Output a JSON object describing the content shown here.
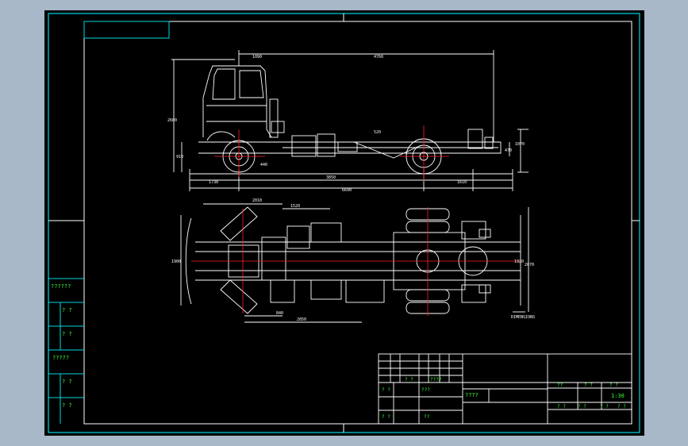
{
  "sidebar": {
    "labels": [
      "??????",
      "? ?",
      "? ?",
      "?????",
      "? ?",
      "? ?"
    ]
  },
  "title_block": {
    "left_grid": [
      "? ?",
      "????",
      "? ?",
      "???",
      "? ?",
      "??"
    ],
    "drawing_name": "????",
    "right_header": [
      "??",
      "? ?",
      "? ?"
    ],
    "scale": "1:30",
    "footer": [
      "? ?",
      "? ?",
      "? ?",
      "? ?"
    ]
  },
  "dimensions": {
    "side_view": {
      "top_a": "1090",
      "top_b": "4760",
      "height_total": "2600",
      "height_frame": "910",
      "right_a": "1070",
      "right_b": "470",
      "label_mid": "520",
      "label_left": "440",
      "bottom_a": "1730",
      "bottom_b": "3850",
      "bottom_c": "1610",
      "bottom_total": "6690"
    },
    "plan_view": {
      "top_a": "2010",
      "top_b": "1520",
      "left_width": "1900",
      "right_a": "1920",
      "right_b": "2070",
      "bottom_a": "840",
      "bottom_b": "2850",
      "note": "DIMENSIONS"
    }
  },
  "colors": {
    "background": "#a8b8c8",
    "sheet": "#000000",
    "border": "#00d8e0",
    "drawing": "#ffffff",
    "centerline": "#ff2020",
    "text": "#39ff39"
  }
}
